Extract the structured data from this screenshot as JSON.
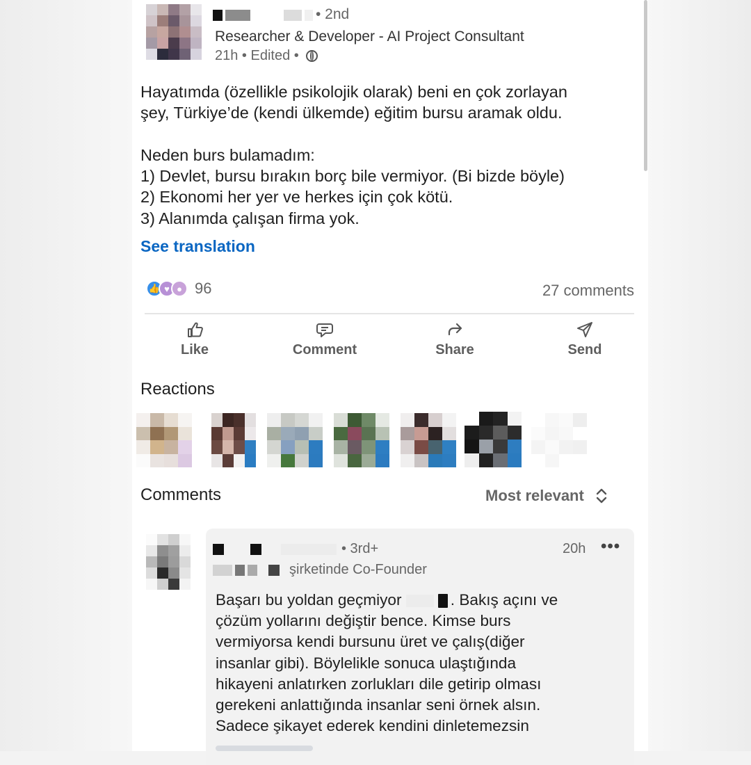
{
  "post": {
    "degree": "• 2nd",
    "headline": "Researcher & Developer - AI Project Consultant",
    "time": "21h • Edited •",
    "text_lines": [
      "Hayatımda (özellikle psikolojik olarak) beni en çok zorlayan",
      "şey, Türkiye’de (kendi ülkemde) eğitim bursu aramak oldu.",
      "",
      "Neden burs bulamadım:",
      "1) Devlet, bursu bırakın borç bile vermiyor. (Bi bizde böyle)",
      "2) Ekonomi her yer ve herkes için çok kötü.",
      "3) Alanımda çalışan firma yok."
    ],
    "see_translation": "See translation",
    "reaction_count": "96",
    "comments_count": "27 comments",
    "reaction_icons": [
      "like-icon",
      "support-icon",
      "insightful-icon"
    ]
  },
  "actions": [
    {
      "label": "Like",
      "icon": "like-icon"
    },
    {
      "label": "Comment",
      "icon": "comment-icon"
    },
    {
      "label": "Share",
      "icon": "share-icon"
    },
    {
      "label": "Send",
      "icon": "send-icon"
    }
  ],
  "reactions_section": {
    "title": "Reactions"
  },
  "comments_section": {
    "title": "Comments",
    "sort_label": "Most relevant"
  },
  "comment": {
    "degree": "• 3rd+",
    "time": "20h",
    "more": "•••",
    "headline": "şirketinde Co-Founder",
    "lines": [
      "Başarı bu yoldan geçmiyor",
      "çözüm yollarını değiştir bence. Kimse burs",
      "vermiyorsa kendi bursunu üret ve çalış(diğer",
      "insanlar gibi). Böylelikle sonuca ulaştığında",
      "hikayeni anlatırken zorlukları dile getirip olması",
      "gerekeni anlattığında insanlar seni örnek alsın.",
      "Sadece şikayet ederek kendini dinletemezsin"
    ],
    "line1_suffix": ". Bakış açını ve"
  },
  "colors": {
    "link": "#0a66c2",
    "muted": "#666666",
    "bubble": "#f2f2f2"
  }
}
